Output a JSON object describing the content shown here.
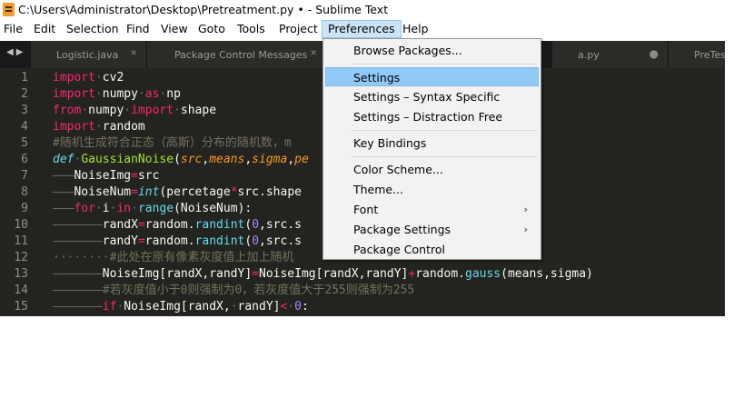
{
  "window": {
    "title": "C:\\Users\\Administrator\\Desktop\\Pretreatment.py • - Sublime Text"
  },
  "menubar": {
    "items": [
      "File",
      "Edit",
      "Selection",
      "Find",
      "View",
      "Goto",
      "Tools",
      "Project",
      "Preferences",
      "Help"
    ],
    "active": "Preferences"
  },
  "tabs": [
    {
      "label": "Logistic.java"
    },
    {
      "label": "Package Control Messages"
    },
    {
      "label": "a.py"
    },
    {
      "label": "PreTest"
    }
  ],
  "colors": {
    "editor_bg": "#23241f",
    "keyword": "#f92672",
    "function": "#a6e22e",
    "builtin": "#66d9ef",
    "parameter": "#fd971f",
    "number": "#ae81ff",
    "comment": "#75715e",
    "menu_highlight": "#91c9f7"
  },
  "code": {
    "line_numbers": [
      "1",
      "2",
      "3",
      "4",
      "5",
      "6",
      "7",
      "8",
      "9",
      "10",
      "11",
      "12",
      "13",
      "14",
      "15"
    ],
    "line1": {
      "kw": "import",
      "rest": "cv2"
    },
    "line2": {
      "kw": "import",
      "mod": "numpy",
      "as": "as",
      "alias": "np"
    },
    "line3": {
      "kw": "from",
      "mod": "numpy",
      "kw2": "import",
      "name": "shape"
    },
    "line4": {
      "kw": "import",
      "mod": "random"
    },
    "line5": {
      "comment": "#随机生成符合正态（高斯）分布的随机数，m"
    },
    "line6": {
      "def": "def",
      "fn": "GaussianNoise",
      "open": "(",
      "p1": "src",
      "p2": "means",
      "p3": "sigma",
      "p4": "pe"
    },
    "line7": {
      "lhs": "NoiseImg",
      "op": "=",
      "rhs": "src"
    },
    "line8": {
      "lhs": "NoiseNum",
      "op": "=",
      "fn": "int",
      "args": "(percetage",
      "op2": "*",
      "rest": "src.shape"
    },
    "line9": {
      "kw": "for",
      "var": "i",
      "kw2": "in",
      "fn": "range",
      "rest": "(NoiseNum):"
    },
    "line10": {
      "lhs": "randX",
      "op": "=",
      "mod": "random.",
      "fn": "randint",
      "open": "(",
      "num": "0",
      "rest": ",src.s"
    },
    "line11": {
      "lhs": "randY",
      "op": "=",
      "mod": "random.",
      "fn": "randint",
      "open": "(",
      "num": "0",
      "rest": ",src.s"
    },
    "line12": {
      "comment": "#此处在原有像素灰度值上加上随机"
    },
    "line13": {
      "lhs": "NoiseImg[randX,randY]",
      "op": "=",
      "mid": "NoiseImg[randX,randY]",
      "op2": "+",
      "mod": "random.",
      "fn": "gauss",
      "rest": "(means,sigma)"
    },
    "line14": {
      "comment": "#若灰度值小于0则强制为0，若灰度值大于255则强制为255"
    },
    "line15": {
      "kw": "if",
      "mid": "NoiseImg[randX,",
      "mid2": "randY]",
      "op": "<",
      "num": "0",
      "end": ":"
    }
  },
  "preferences_menu": {
    "items": [
      {
        "label": "Browse Packages..."
      },
      {
        "label": "Settings"
      },
      {
        "label": "Settings – Syntax Specific"
      },
      {
        "label": "Settings – Distraction Free"
      },
      {
        "label": "Key Bindings"
      },
      {
        "label": "Color Scheme..."
      },
      {
        "label": "Theme..."
      },
      {
        "label": "Font"
      },
      {
        "label": "Package Settings"
      },
      {
        "label": "Package Control"
      }
    ],
    "highlighted": "Settings",
    "submenu_arrow": "›"
  }
}
